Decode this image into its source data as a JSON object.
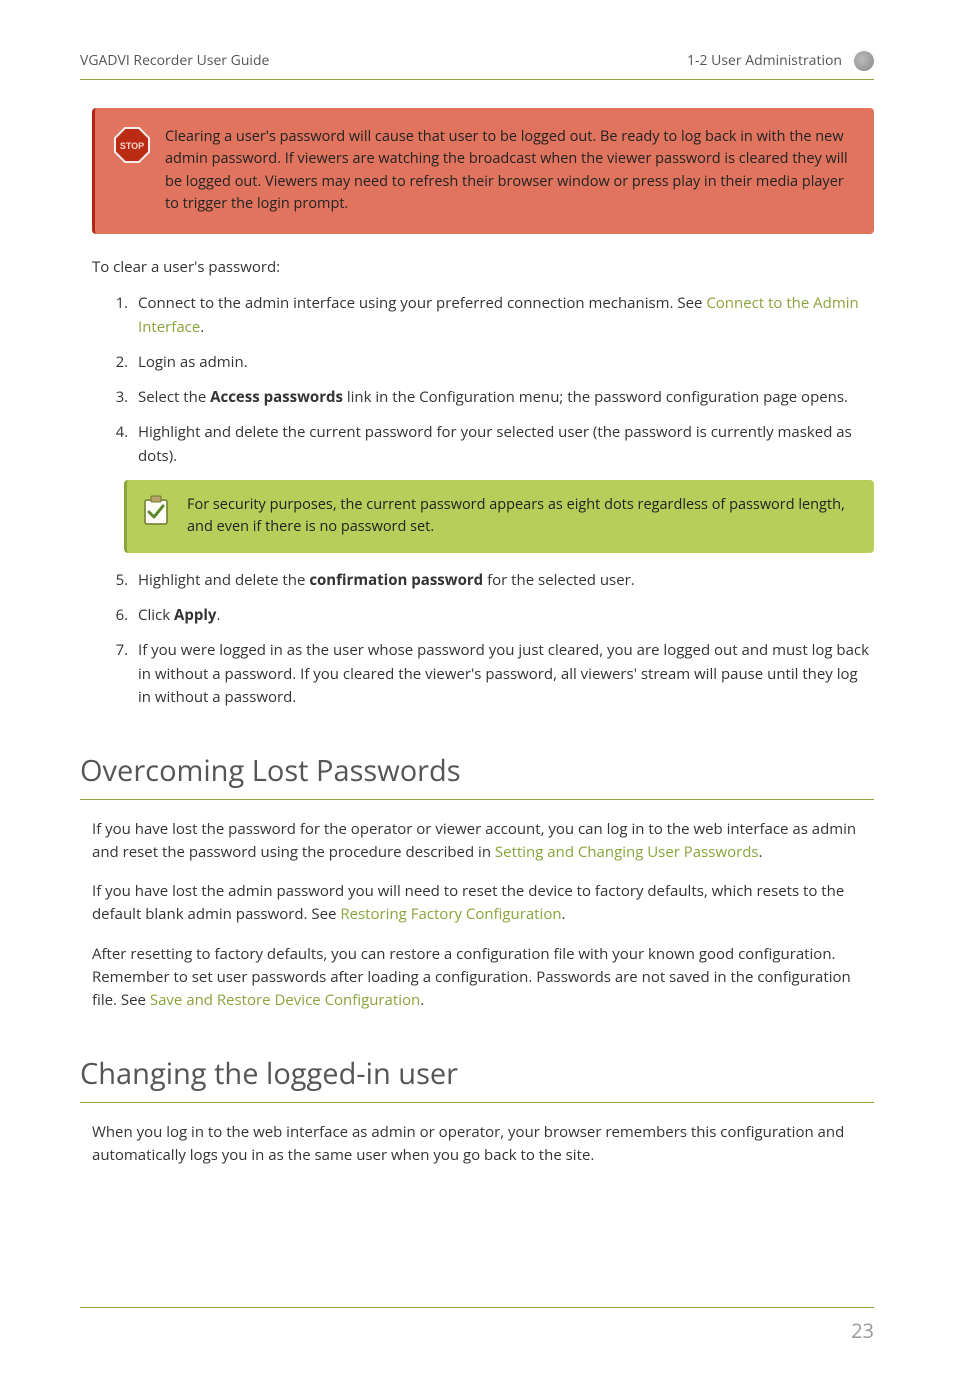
{
  "header": {
    "left": "VGADVI Recorder User Guide",
    "right": "1-2 User Administration"
  },
  "stop_callout": "Clearing a user's password will cause that user to be logged out. Be ready to log back in with the new admin password. If viewers are watching the broadcast when the viewer password is cleared they will be logged out. Viewers may need to refresh their browser window or press play in their media player to trigger the login prompt.",
  "intro": "To clear a user's password:",
  "steps": {
    "s1a": "Connect to the admin interface using your preferred connection mechanism. See ",
    "s1_link": "Connect to the Admin Interface",
    "s1b": ".",
    "s2": "Login as admin.",
    "s3a": "Select the ",
    "s3b": "Access passwords",
    "s3c": " link in the Configuration menu; the password configuration page opens.",
    "s4": "Highlight and delete the current password for your selected user (the password is currently masked as dots).",
    "note": "For security purposes, the current password appears as eight dots regardless of password length, and even if there is no password set.",
    "s5a": "Highlight and delete the ",
    "s5b": "confirmation password",
    "s5c": " for the selected user.",
    "s6a": "Click ",
    "s6b": "Apply",
    "s6c": ".",
    "s7": "If you were logged in as the user whose password you just cleared, you are logged out and must log back in without a password. If you cleared the viewer's password, all viewers' stream will pause until they log in without a password."
  },
  "section1": {
    "title": "Overcoming Lost Passwords",
    "p1a": "If you have lost the password for the operator or viewer account, you can log in to the web interface as admin and reset the password using the procedure described in ",
    "p1_link": "Setting and Changing User Passwords",
    "p1b": ".",
    "p2a": "If you have lost the admin password you will need to reset the device to factory defaults, which resets to the default blank admin password. See ",
    "p2_link": "Restoring Factory Configuration",
    "p2b": ".",
    "p3a": "After resetting to factory defaults, you can restore a configuration file with your known good configuration. Remember to set user passwords after loading a configuration. Passwords are not saved in the configuration file. See  ",
    "p3_link": "Save and Restore Device Configuration",
    "p3b": "."
  },
  "section2": {
    "title": "Changing the logged-in user",
    "p1": "When you log in to the web interface as admin or operator, your browser remembers this configuration and automatically logs you in as the same user when you go back to the site."
  },
  "page_number": "23"
}
